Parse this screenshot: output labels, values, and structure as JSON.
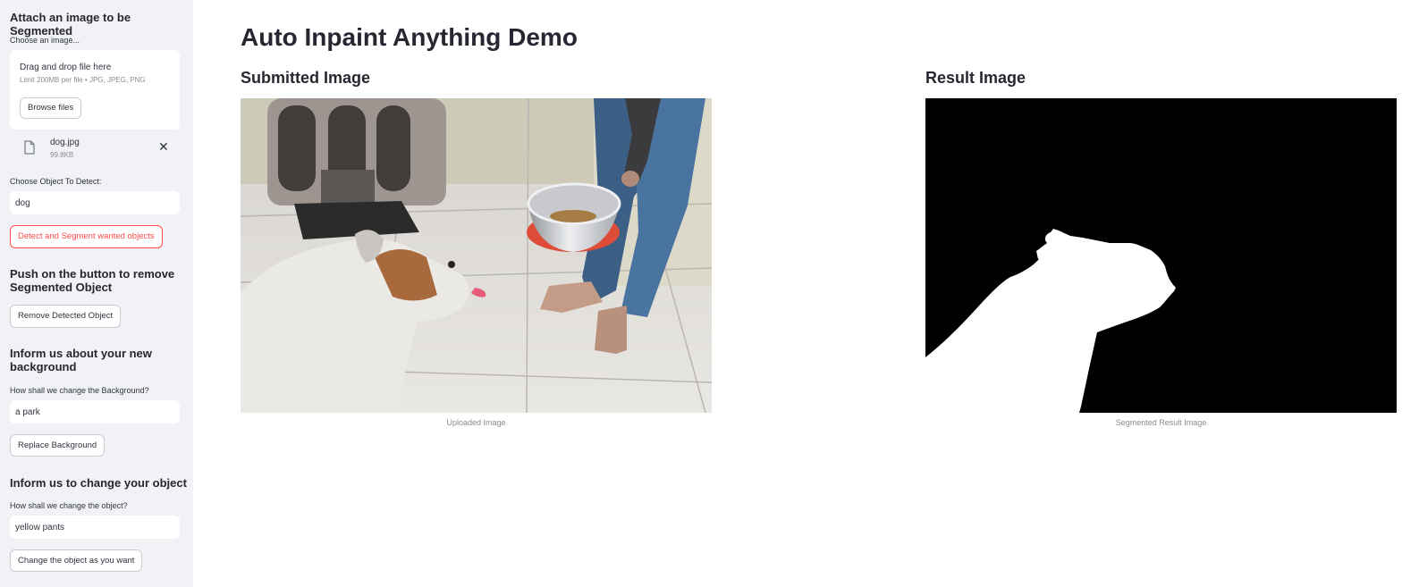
{
  "sidebar": {
    "upload_heading": "Attach an image to be Segmented",
    "upload_label": "Choose an image...",
    "dropzone_title": "Drag and drop file here",
    "dropzone_limit": "Limit 200MB per file • JPG, JPEG, PNG",
    "browse_label": "Browse files",
    "file": {
      "name": "dog.jpg",
      "size": "99.8KB",
      "icon": "file-icon",
      "remove_icon": "close-icon"
    },
    "detect_label": "Choose Object To Detect:",
    "detect_value": "dog",
    "detect_button": "Detect and Segment wanted objects",
    "remove_heading": "Push on the button to remove Segmented Object",
    "remove_button": "Remove Detected Object",
    "bg_heading": "Inform us about your new background",
    "bg_label": "How shall we change the Background?",
    "bg_value": "a park",
    "bg_button": "Replace Background",
    "obj_heading": "Inform us to change your object",
    "obj_label": "How shall we change the object?",
    "obj_value": "yellow pants",
    "obj_button": "Change the object as you want"
  },
  "main": {
    "title": "Auto Inpaint Anything Demo",
    "submitted_heading": "Submitted Image",
    "submitted_caption": "Uploaded Image",
    "result_heading": "Result Image",
    "result_caption": "Segmented Result Image"
  },
  "colors": {
    "accent": "#ff4b4b",
    "sidebar_bg": "#f0f2f6",
    "text": "#31333f"
  }
}
